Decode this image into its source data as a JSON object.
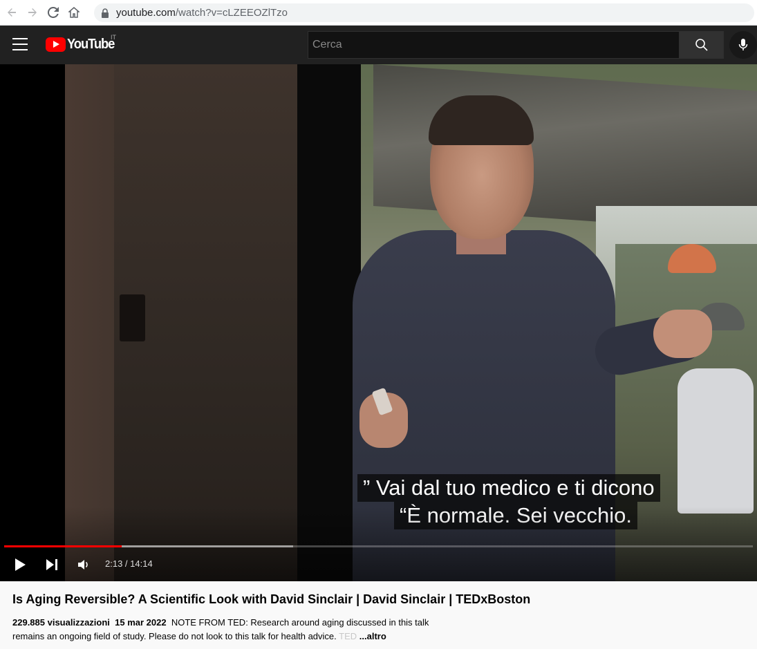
{
  "browser": {
    "url_host": "youtube.com",
    "url_path": "/watch?v=cLZEEOZlTzo"
  },
  "header": {
    "logo_text": "YouTube",
    "country_code": "IT",
    "search_placeholder": "Cerca"
  },
  "player": {
    "subtitle_line1": "” Vai dal tuo medico e ti dicono",
    "subtitle_line2": "“È normale.  Sei vecchio.",
    "time": "2:13 / 14:14",
    "progress_played": 0.157,
    "progress_buffered": 0.386
  },
  "video": {
    "title": "Is Aging Reversible? A Scientific Look with David Sinclair | David Sinclair | TEDxBoston",
    "views": "229.885 visualizzazioni",
    "date": "15 mar 2022",
    "description": "NOTE FROM TED: Research around aging discussed in this talk remains an ongoing field of study. Please do not look to this talk for health advice.",
    "description_faded": "TED",
    "more_label": "...altro"
  },
  "colors": {
    "accent": "#ff0000",
    "header_bg": "#212121",
    "page_bg": "#f9f9f9"
  }
}
